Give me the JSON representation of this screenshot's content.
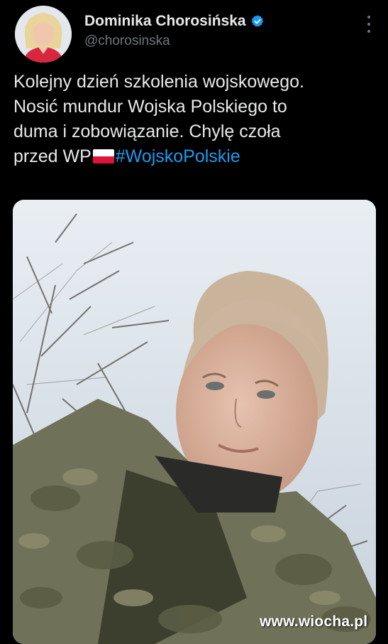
{
  "author": {
    "display_name": "Dominika Chorosińska",
    "handle": "@chorosinska",
    "verified": true,
    "avatar_icon": "profile-photo"
  },
  "post": {
    "line1": "Kolejny dzień szkolenia wojskowego.",
    "line2": "Nosić mundur Wojska Polskiego to",
    "line3": "duma i zobowiązanie. Chylę czoła",
    "line4_prefix": "przed WP",
    "flag_icon": "poland-flag-emoji",
    "hashtag": "#WojskoPolskie"
  },
  "media": {
    "watermark": "www.wiocha.pl"
  },
  "colors": {
    "background": "#000000",
    "text": "#e7e9ea",
    "muted": "#71767b",
    "link": "#1d9bf0",
    "verified": "#1d9bf0"
  },
  "icons": [
    "verified-badge-icon",
    "more-options-icon"
  ]
}
